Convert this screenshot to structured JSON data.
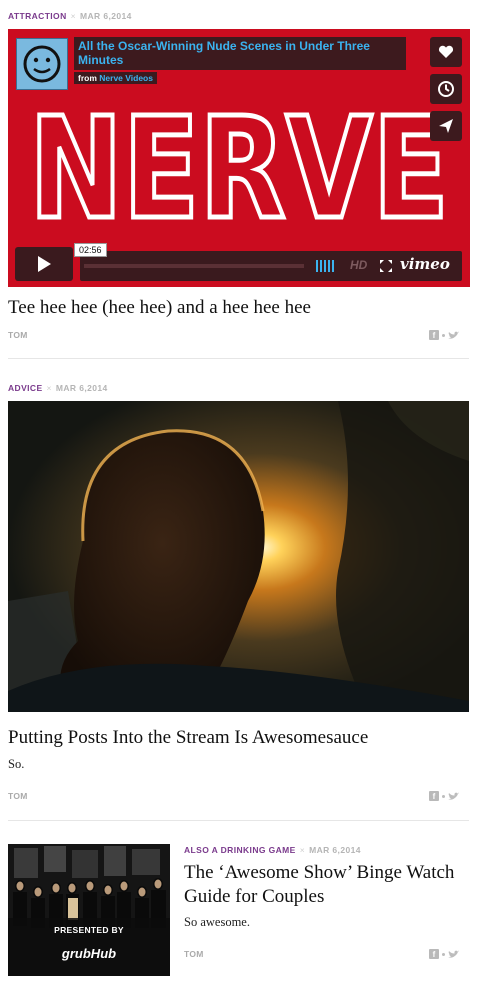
{
  "posts": [
    {
      "category": "Attraction",
      "date": "Mar 6,2014",
      "title": "Tee hee hee (hee hee) and a hee hee hee",
      "author": "Tom",
      "video": {
        "title": "All the Oscar-Winning Nude Scenes in Under Three Minutes",
        "from_label": "from",
        "from_source": "Nerve Videos",
        "wordmark": "NERVE",
        "time": "02:56",
        "hd_label": "HD",
        "vimeo_label": "vimeo"
      }
    },
    {
      "category": "Advice",
      "date": "Mar 6,2014",
      "title": "Putting Posts Into the Stream Is Awesomesauce",
      "excerpt": "So.",
      "author": "Tom"
    },
    {
      "category": "Also a drinking game",
      "date": "Mar 6,2014",
      "title": "The ‘Awesome Show’ Binge Watch Guide for Couples",
      "excerpt": "So awesome.",
      "author": "Tom",
      "thumb": {
        "presented_by": "PRESENTED BY",
        "sponsor": "grubHub"
      }
    }
  ],
  "colors": {
    "accent": "#7a3a8c",
    "video_red": "#cb0c1f",
    "vimeo_blue": "#3bb3ef"
  },
  "icons": [
    "heart-icon",
    "clock-icon",
    "send-icon",
    "play-icon",
    "facebook-icon",
    "twitter-icon"
  ]
}
